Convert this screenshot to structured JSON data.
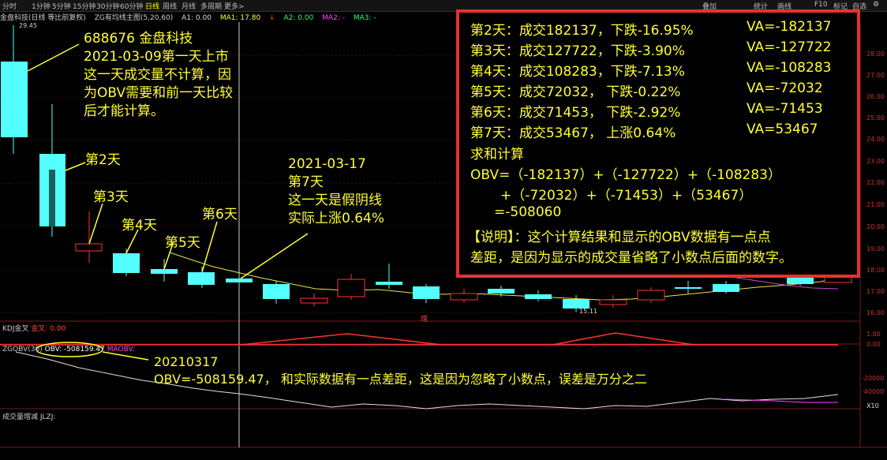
{
  "toolbar": {
    "items": [
      "分时",
      "1分钟",
      "5分钟",
      "15分钟",
      "30分钟",
      "60分钟",
      "日线",
      "周线",
      "月线",
      "多周期",
      "更多>"
    ],
    "active_index": 6,
    "right_items": [
      "叠加",
      "统计",
      "画线",
      "F10",
      "标记",
      "自选"
    ]
  },
  "header": {
    "stock": "金盘科技(日线 等比前复权)",
    "indicator": "ZG有均线主图(5,20,60)",
    "a1": "A1: 0.00",
    "ma1": "MA1: 17.80",
    "arrow": "↓",
    "a2": "A2: 0.00",
    "ma2": "MA2: -",
    "ma3": "MA3: -"
  },
  "price_axis": [
    "28.00",
    "27.00",
    "26.00",
    "25.00",
    "24.00",
    "23.00",
    "22.00",
    "21.00",
    "20.00",
    "19.00",
    "18.00",
    "17.00",
    "16.00"
  ],
  "high_label": "29.45",
  "low_label": "15.11",
  "marker_text": "增",
  "kdj": {
    "label": "KDJ金叉",
    "sub": "金叉: 0.00",
    "axis": [
      "1.00",
      "0.00"
    ]
  },
  "obv": {
    "label": "ZGOBV(30)",
    "value": "OBV: -508159.47",
    "sub": "MAOBV:",
    "axis": [
      "-20000",
      "-40000"
    ],
    "unit": "X10"
  },
  "vol": {
    "label": "成交量增减 JLZJ:"
  },
  "annotations": {
    "intro": [
      "688676  金盘科技",
      "2021-03-09第一天上市",
      "这一天成交量不计算，因",
      "为OBV需要和前一天比较",
      "后才能计算。"
    ],
    "day2": "第2天",
    "day3": "第3天",
    "day4": "第4天",
    "day5": "第5天",
    "day6": "第6天",
    "day7": [
      "2021-03-17",
      "第7天",
      "这一天是假阴线",
      "实际上涨0.64%"
    ],
    "obv_note": [
      "20210317",
      "OBV=-508159.47， 和实际数据有一点差距，这是因为忽略了小数点，误差是万分之二"
    ]
  },
  "calc": {
    "rows": [
      {
        "text": "第2天：成交182137，下跌-16.95%",
        "va": "VA=-182137"
      },
      {
        "text": "第3天：成交127722，下跌-3.90%",
        "va": "VA=-127722"
      },
      {
        "text": "第4天：成交108283，下跌-7.13%",
        "va": "VA=-108283"
      },
      {
        "text": "第5天：成交72032，  下跌-0.22%",
        "va": "VA=-72032"
      },
      {
        "text": "第6天：成交71453，  下跌-2.92%",
        "va": "VA=-71453"
      },
      {
        "text": "第7天：成交53467，  上涨0.64%",
        "va": " VA=53467"
      }
    ],
    "sum_title": "求和计算",
    "formula": [
      "OBV=（-182137）+（-127722）+（-108283）",
      "+（-72032）+（-71453）+（53467）",
      "=-508060"
    ],
    "note": [
      "【说明】：这个计算结果和显示的OBV数据有一点点",
      "差距，是因为显示的成交量省略了小数点后面的数字。"
    ]
  },
  "colors": {
    "up": "#ff3232",
    "down": "#54ffff",
    "anno": "#ffff33",
    "box": "#e83030"
  }
}
